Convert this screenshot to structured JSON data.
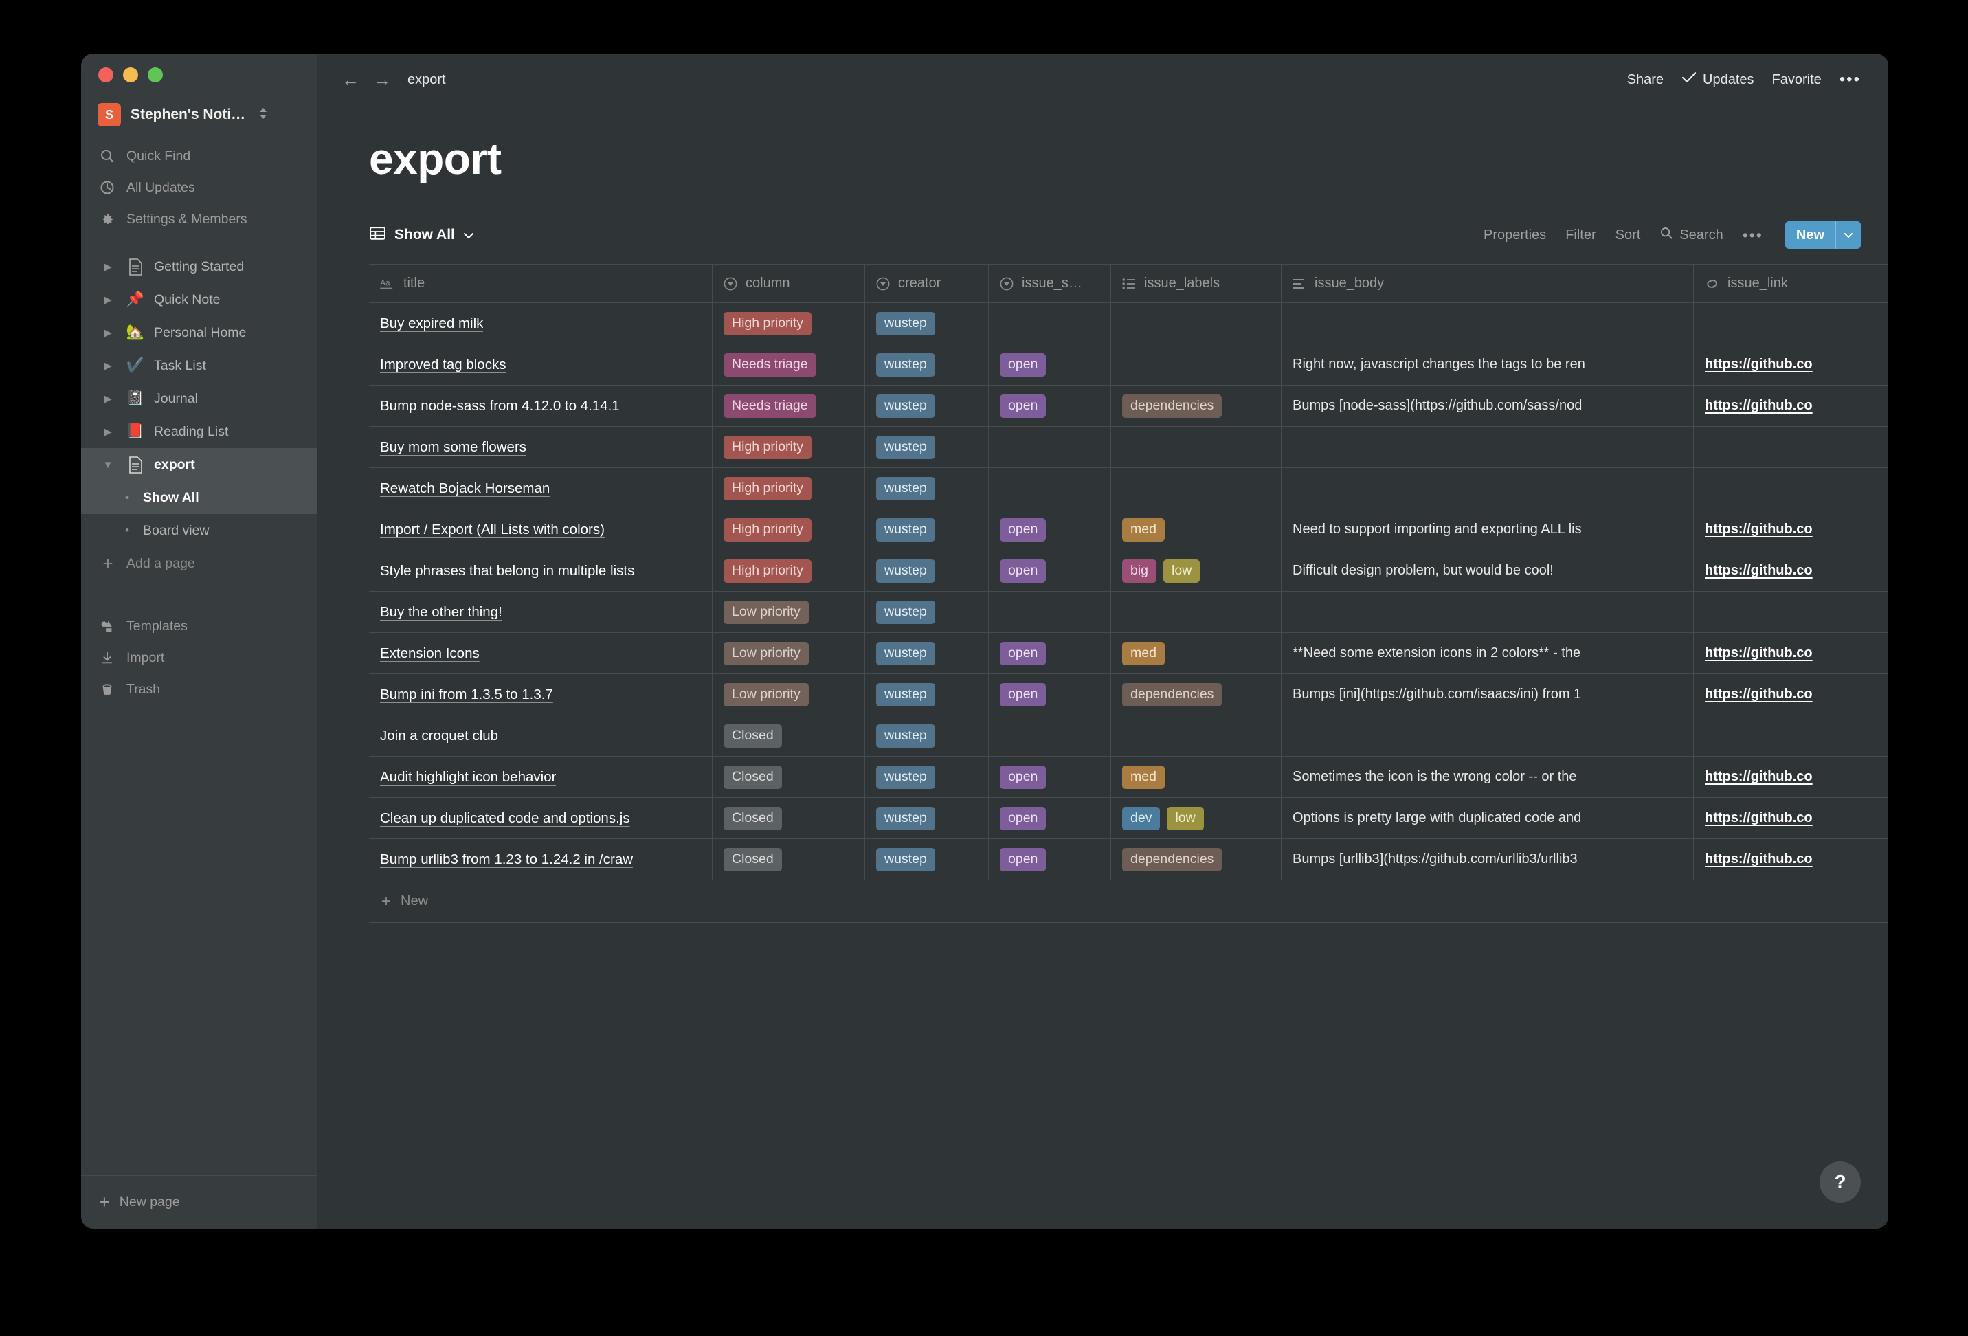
{
  "window": {
    "traffic_lights": [
      "close",
      "minimize",
      "maximize"
    ]
  },
  "sidebar": {
    "workspace": {
      "badge": "S",
      "name": "Stephen's Noti…"
    },
    "nav": [
      {
        "icon": "search-icon",
        "label": "Quick Find"
      },
      {
        "icon": "clock-icon",
        "label": "All Updates"
      },
      {
        "icon": "gear-icon",
        "label": "Settings & Members"
      }
    ],
    "pages": [
      {
        "icon": "document-icon",
        "label": "Getting Started"
      },
      {
        "icon": "pushpin-icon",
        "label": "Quick Note"
      },
      {
        "icon": "house-icon",
        "label": "Personal Home"
      },
      {
        "icon": "checkmark-icon",
        "label": "Task List"
      },
      {
        "icon": "notebook-icon",
        "label": "Journal"
      },
      {
        "icon": "closed-book-icon",
        "label": "Reading List"
      },
      {
        "icon": "document-icon",
        "label": "export"
      }
    ],
    "subpages": [
      {
        "label": "Show All",
        "active": true
      },
      {
        "label": "Board view",
        "active": false
      }
    ],
    "add_page_label": "Add a page",
    "bottom": [
      {
        "icon": "templates-icon",
        "label": "Templates"
      },
      {
        "icon": "import-icon",
        "label": "Import"
      },
      {
        "icon": "trash-icon",
        "label": "Trash"
      }
    ],
    "footer": {
      "icon": "plus-icon",
      "label": "New page"
    }
  },
  "topbar": {
    "back": "back-arrow-icon",
    "forward": "forward-arrow-icon",
    "breadcrumb": "export",
    "share": "Share",
    "updates": "Updates",
    "favorite": "Favorite",
    "more": "•••"
  },
  "page": {
    "title": "export"
  },
  "viewbar": {
    "view_name": "Show All",
    "properties": "Properties",
    "filter": "Filter",
    "sort": "Sort",
    "search": "Search",
    "more": "•••",
    "new_label": "New",
    "new_color": "#529cca"
  },
  "table": {
    "columns": [
      {
        "key": "title",
        "label": "title",
        "icon": "text-aa-icon"
      },
      {
        "key": "column",
        "label": "column",
        "icon": "select-icon"
      },
      {
        "key": "creator",
        "label": "creator",
        "icon": "select-icon"
      },
      {
        "key": "issue_status",
        "label": "issue_s…",
        "icon": "select-icon"
      },
      {
        "key": "issue_labels",
        "label": "issue_labels",
        "icon": "multiselect-icon"
      },
      {
        "key": "issue_body",
        "label": "issue_body",
        "icon": "text-lines-icon"
      },
      {
        "key": "issue_link",
        "label": "issue_link",
        "icon": "link-icon"
      }
    ],
    "rows": [
      {
        "title": "Buy expired milk",
        "column": "High priority",
        "column_style": "p-high",
        "creator": "wustep",
        "issue_status": "",
        "labels": [],
        "issue_body": "",
        "issue_link": ""
      },
      {
        "title": "Improved tag blocks",
        "column": "Needs triage",
        "column_style": "p-needs",
        "creator": "wustep",
        "issue_status": "open",
        "labels": [],
        "issue_body": "Right now, javascript changes the tags to be ren",
        "issue_link": "https://github.co"
      },
      {
        "title": "Bump node-sass from 4.12.0 to 4.14.1",
        "column": "Needs triage",
        "column_style": "p-needs",
        "creator": "wustep",
        "issue_status": "open",
        "labels": [
          {
            "text": "dependencies",
            "style": "p-dep"
          }
        ],
        "issue_body": "Bumps [node-sass](https://github.com/sass/nod",
        "issue_link": "https://github.co"
      },
      {
        "title": "Buy mom some flowers",
        "column": "High priority",
        "column_style": "p-high",
        "creator": "wustep",
        "issue_status": "",
        "labels": [],
        "issue_body": "",
        "issue_link": ""
      },
      {
        "title": "Rewatch Bojack Horseman",
        "column": "High priority",
        "column_style": "p-high",
        "creator": "wustep",
        "issue_status": "",
        "labels": [],
        "issue_body": "",
        "issue_link": ""
      },
      {
        "title": "Import / Export (All Lists with colors)",
        "column": "High priority",
        "column_style": "p-high",
        "creator": "wustep",
        "issue_status": "open",
        "labels": [
          {
            "text": "med",
            "style": "p-med"
          }
        ],
        "issue_body": "Need to support importing and exporting ALL lis",
        "issue_link": "https://github.co"
      },
      {
        "title": "Style phrases that belong in multiple lists",
        "column": "High priority",
        "column_style": "p-high",
        "creator": "wustep",
        "issue_status": "open",
        "labels": [
          {
            "text": "big",
            "style": "p-big"
          },
          {
            "text": "low",
            "style": "p-low2"
          }
        ],
        "issue_body": "Difficult design problem, but would be cool!",
        "issue_link": "https://github.co"
      },
      {
        "title": "Buy the other thing!",
        "column": "Low priority",
        "column_style": "p-low",
        "creator": "wustep",
        "issue_status": "",
        "labels": [],
        "issue_body": "",
        "issue_link": ""
      },
      {
        "title": "Extension Icons",
        "column": "Low priority",
        "column_style": "p-low",
        "creator": "wustep",
        "issue_status": "open",
        "labels": [
          {
            "text": "med",
            "style": "p-med"
          }
        ],
        "issue_body": "**Need some extension icons in 2 colors** - the",
        "issue_link": "https://github.co"
      },
      {
        "title": "Bump ini from 1.3.5 to 1.3.7",
        "column": "Low priority",
        "column_style": "p-low",
        "creator": "wustep",
        "issue_status": "open",
        "labels": [
          {
            "text": "dependencies",
            "style": "p-dep"
          }
        ],
        "issue_body": "Bumps [ini](https://github.com/isaacs/ini) from 1",
        "issue_link": "https://github.co"
      },
      {
        "title": "Join a croquet club",
        "column": "Closed",
        "column_style": "p-closed",
        "creator": "wustep",
        "issue_status": "",
        "labels": [],
        "issue_body": "",
        "issue_link": ""
      },
      {
        "title": "Audit highlight icon behavior",
        "column": "Closed",
        "column_style": "p-closed",
        "creator": "wustep",
        "issue_status": "open",
        "labels": [
          {
            "text": "med",
            "style": "p-med"
          }
        ],
        "issue_body": "Sometimes the icon is the wrong color -- or the",
        "issue_link": "https://github.co"
      },
      {
        "title": "Clean up duplicated code and options.js",
        "column": "Closed",
        "column_style": "p-closed",
        "creator": "wustep",
        "issue_status": "open",
        "labels": [
          {
            "text": "dev",
            "style": "p-dev"
          },
          {
            "text": "low",
            "style": "p-low2"
          }
        ],
        "issue_body": "Options is pretty large with duplicated code and",
        "issue_link": "https://github.co"
      },
      {
        "title": "Bump urllib3 from 1.23 to 1.24.2 in /craw",
        "column": "Closed",
        "column_style": "p-closed",
        "creator": "wustep",
        "issue_status": "open",
        "labels": [
          {
            "text": "dependencies",
            "style": "p-dep"
          }
        ],
        "issue_body": "Bumps [urllib3](https://github.com/urllib3/urllib3",
        "issue_link": "https://github.co"
      }
    ],
    "new_row_label": "New"
  },
  "help": {
    "label": "?"
  }
}
